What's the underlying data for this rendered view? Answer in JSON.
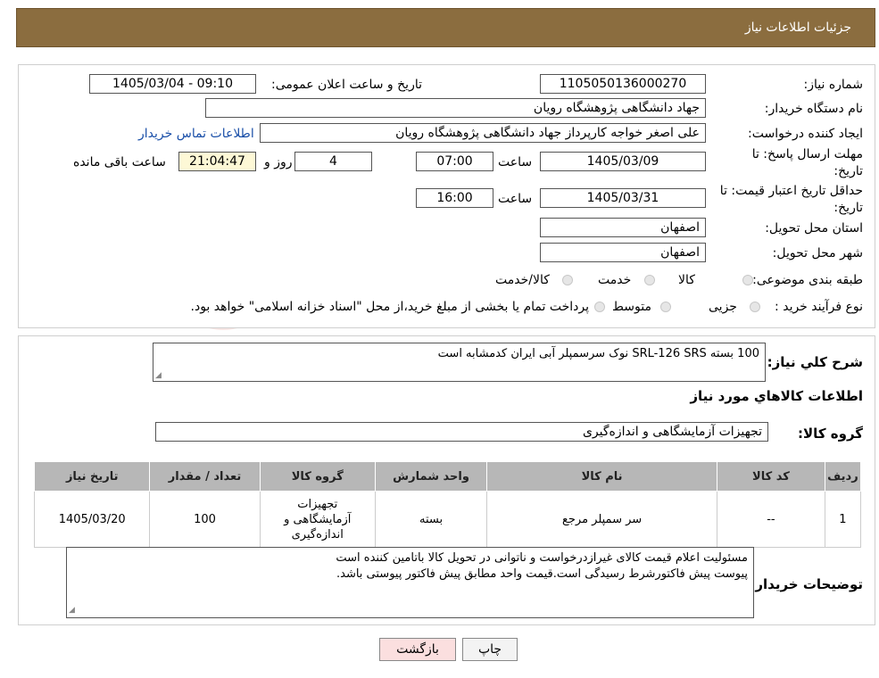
{
  "header": {
    "title": "جزئیات اطلاعات نیاز"
  },
  "fields": {
    "need_number_label": "شماره نیاز:",
    "need_number": "1105050136000270",
    "announce_label": "تاریخ و ساعت اعلان عمومی:",
    "announce_value": "1405/03/04 - 09:10",
    "buyer_org_label": "نام دستگاه خریدار:",
    "buyer_org": "جهاد دانشگاهی پژوهشگاه رویان",
    "creator_label": "ایجاد کننده درخواست:",
    "creator": "علی اصغر خواجه کارپرداز جهاد دانشگاهی پژوهشگاه رویان",
    "contact_link": "اطلاعات تماس خریدار",
    "deadline_label_1": "مهلت ارسال پاسخ: تا",
    "deadline_label_2": "تاریخ:",
    "deadline_date": "1405/03/09",
    "time_label": "ساعت",
    "deadline_time": "07:00",
    "days_value": "4",
    "days_label": "روز و",
    "remaining_time": "21:04:47",
    "remaining_label": "ساعت باقی مانده",
    "validity_label_1": "حداقل تاریخ اعتبار قیمت: تا",
    "validity_label_2": "تاریخ:",
    "validity_date": "1405/03/31",
    "validity_time": "16:00",
    "province_label": "استان محل تحویل:",
    "province": "اصفهان",
    "city_label": "شهر محل تحویل:",
    "city": "اصفهان",
    "category_label": "طبقه بندی موضوعی:",
    "category_options": [
      "کالا",
      "خدمت",
      "کالا/خدمت"
    ],
    "purchase_type_label": "نوع فرآیند خرید :",
    "purchase_options": [
      "جزیی",
      "متوسط"
    ],
    "purchase_note": "پرداخت تمام یا بخشی از مبلغ خرید،از محل \"اسناد خزانه اسلامی\" خواهد بود."
  },
  "summary": {
    "label": "شرح کلي نياز:",
    "text": "100 بسته          SRL-126     SRS   نوک سرسمپلر آبی  ایران کدمشابه است",
    "goods_info_title": "اطلاعات کالاهاي مورد نياز",
    "group_label": "گروه کالا:",
    "group_value": "تجهیزات آزمایشگاهی و اندازه‌گیری"
  },
  "table": {
    "headers": [
      "ردیف",
      "کد کالا",
      "نام کالا",
      "واحد شمارش",
      "گروه کالا",
      "تعداد / مقدار",
      "تاریخ نیاز"
    ],
    "rows": [
      {
        "row": "1",
        "code": "--",
        "name": "سر سمپلر مرجع",
        "unit": "بسته",
        "group": "تجهیزات آزمایشگاهی و اندازه‌گیری",
        "qty": "100",
        "date": "1405/03/20"
      }
    ]
  },
  "buyer_notes": {
    "label": "توضیحات خریدار:",
    "line1": "مسئولیت اعلام قیمت کالای غیرازدرخواست و ناتوانی در تحویل کالا باتامین کننده است",
    "line2": "پیوست پیش فاکتورشرط رسیدگی است.قیمت واحد مطابق پیش فاکتور پیوستی باشد."
  },
  "buttons": {
    "print": "چاپ",
    "back": "بازگشت"
  },
  "colors": {
    "header_bg": "#8b6d3f",
    "link": "#1a4fa8",
    "back_btn_bg": "#fbdfdf",
    "timer_bg": "#fdf8d6"
  }
}
